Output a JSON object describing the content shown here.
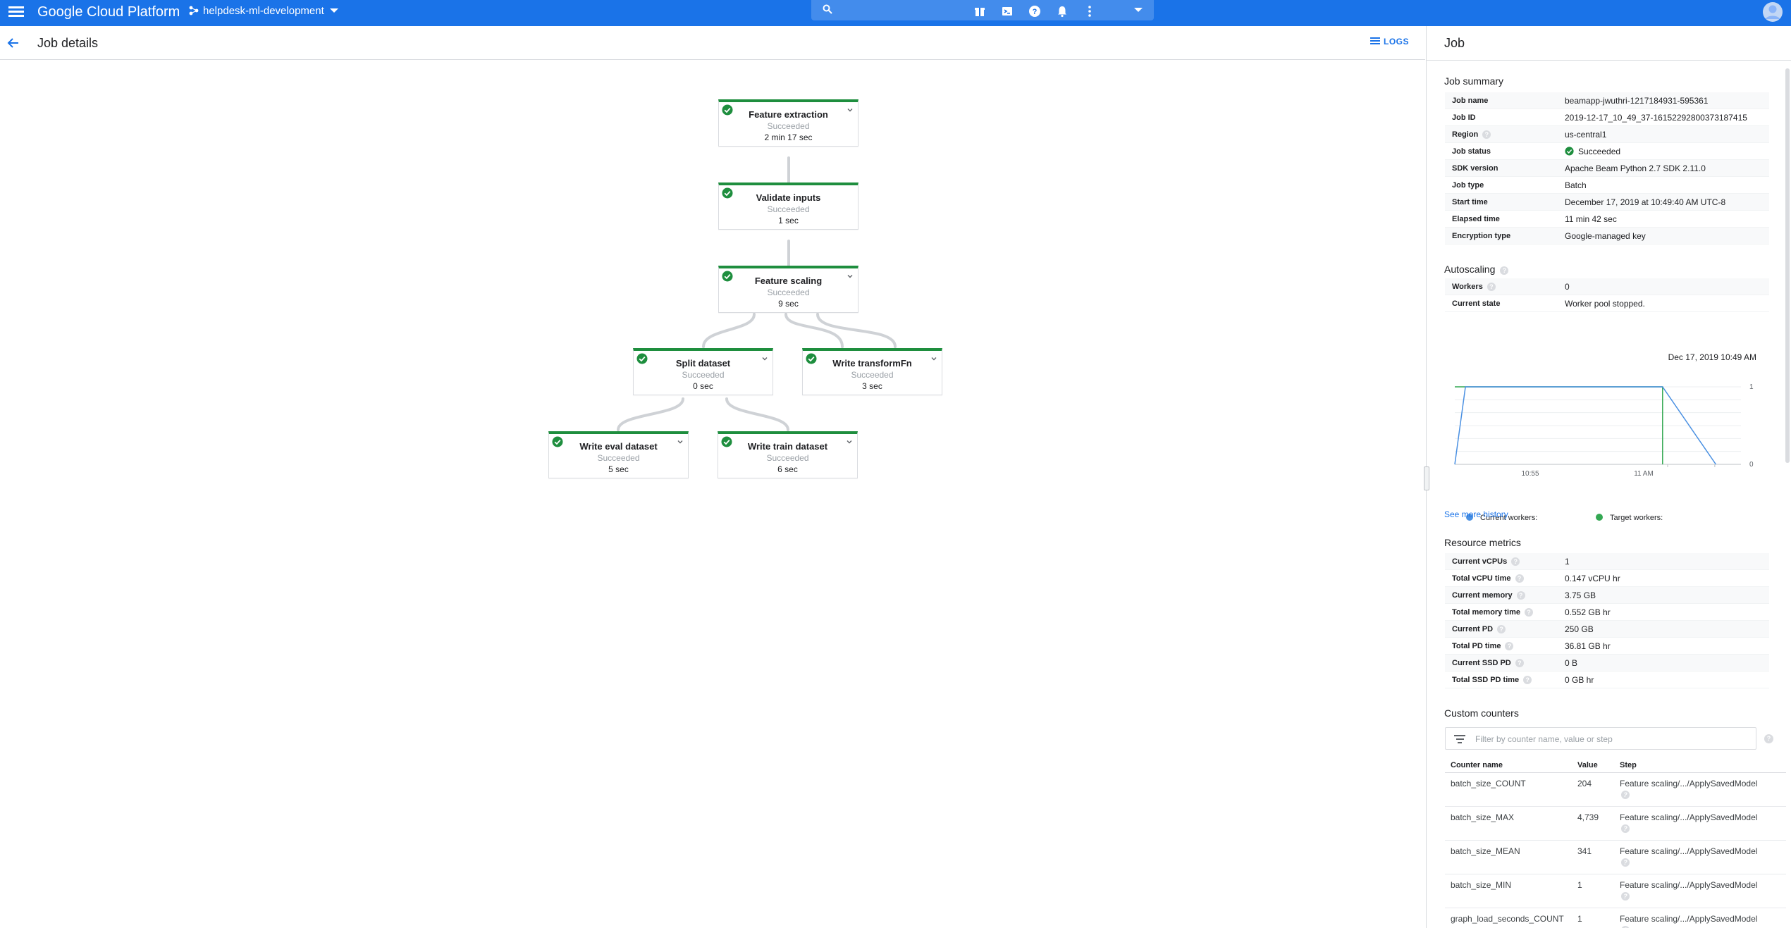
{
  "topbar": {
    "brand": "Google Cloud Platform",
    "project": "helpdesk-ml-development",
    "search_placeholder": "",
    "icons": [
      "gift-icon",
      "cloud-shell-icon",
      "help-icon",
      "notifications-icon",
      "more-vert-icon",
      "account-avatar-icon"
    ]
  },
  "page": {
    "title": "Job details",
    "logs_label": "LOGS"
  },
  "graph": {
    "nodes": [
      {
        "name": "Feature extraction",
        "status": "Succeeded",
        "time": "2 min 17 sec"
      },
      {
        "name": "Validate inputs",
        "status": "Succeeded",
        "time": "1 sec"
      },
      {
        "name": "Feature scaling",
        "status": "Succeeded",
        "time": "9 sec"
      },
      {
        "name": "Split dataset",
        "status": "Succeeded",
        "time": "0 sec"
      },
      {
        "name": "Write transformFn",
        "status": "Succeeded",
        "time": "3 sec"
      },
      {
        "name": "Write eval dataset",
        "status": "Succeeded",
        "time": "5 sec"
      },
      {
        "name": "Write train dataset",
        "status": "Succeeded",
        "time": "6 sec"
      }
    ],
    "status_color": "#1e8e3e"
  },
  "panel": {
    "title": "Job",
    "summary": {
      "title": "Job summary",
      "rows": [
        {
          "key": "Job name",
          "value": "beamapp-jwuthri-1217184931-595361"
        },
        {
          "key": "Job ID",
          "value": "2019-12-17_10_49_37-16152292800373187415"
        },
        {
          "key": "Region",
          "value": "us-central1",
          "help": "?"
        },
        {
          "key": "Job status",
          "value": "Succeeded"
        },
        {
          "key": "SDK version",
          "value": "Apache Beam Python 2.7 SDK 2.11.0"
        },
        {
          "key": "Job type",
          "value": "Batch"
        },
        {
          "key": "Start time",
          "value": "December 17, 2019 at 10:49:40 AM UTC-8"
        },
        {
          "key": "Elapsed time",
          "value": "11 min 42 sec"
        },
        {
          "key": "Encryption type",
          "value": "Google-managed key"
        }
      ]
    },
    "autoscaling": {
      "title": "Autoscaling",
      "help": "?",
      "rows": [
        {
          "key": "Workers",
          "value": "0",
          "help": "?"
        },
        {
          "key": "Current state",
          "value": "Worker pool stopped."
        }
      ],
      "chart_date": "Dec 17, 2019 10:49 AM",
      "legend": {
        "current": "Current workers:",
        "target": "Target workers:"
      },
      "see_more": "See more history"
    },
    "resources": {
      "title": "Resource metrics",
      "rows": [
        {
          "key": "Current vCPUs",
          "value": "1",
          "help": "?"
        },
        {
          "key": "Total vCPU time",
          "value": "0.147 vCPU hr",
          "help": "?"
        },
        {
          "key": "Current memory",
          "value": "3.75 GB",
          "help": "?"
        },
        {
          "key": "Total memory time",
          "value": "0.552 GB hr",
          "help": "?"
        },
        {
          "key": "Current PD",
          "value": "250 GB",
          "help": "?"
        },
        {
          "key": "Total PD time",
          "value": "36.81 GB hr",
          "help": "?"
        },
        {
          "key": "Current SSD PD",
          "value": "0 B",
          "help": "?"
        },
        {
          "key": "Total SSD PD time",
          "value": "0 GB hr",
          "help": "?"
        }
      ]
    },
    "counters": {
      "title": "Custom counters",
      "filter_placeholder": "Filter by counter name, value or step",
      "help": "?",
      "headers": {
        "name": "Counter name",
        "value": "Value",
        "step": "Step"
      },
      "rows": [
        {
          "name": "batch_size_COUNT",
          "value": "204",
          "step": "Feature scaling/.../ApplySavedModel",
          "help": "?"
        },
        {
          "name": "batch_size_MAX",
          "value": "4,739",
          "step": "Feature scaling/.../ApplySavedModel",
          "help": "?"
        },
        {
          "name": "batch_size_MEAN",
          "value": "341",
          "step": "Feature scaling/.../ApplySavedModel",
          "help": "?"
        },
        {
          "name": "batch_size_MIN",
          "value": "1",
          "step": "Feature scaling/.../ApplySavedModel",
          "help": "?"
        },
        {
          "name": "graph_load_seconds_COUNT",
          "value": "1",
          "step": "Feature scaling/.../ApplySavedModel",
          "help": "?"
        }
      ]
    }
  },
  "chart_data": {
    "type": "line",
    "x_ticks": [
      "10:55",
      "11 AM"
    ],
    "y_ticks": [
      "1",
      "0"
    ],
    "ylim": [
      0,
      1
    ],
    "series": [
      {
        "name": "Current workers:",
        "color": "#4a90e2",
        "points": [
          [
            0,
            0
          ],
          [
            0.04,
            1
          ],
          [
            0.78,
            1
          ],
          [
            0.98,
            0
          ]
        ]
      },
      {
        "name": "Target workers:",
        "color": "#34a853",
        "points": [
          [
            0,
            1
          ],
          [
            0.78,
            1
          ],
          [
            0.78,
            0
          ]
        ]
      }
    ]
  },
  "colors": {
    "accent": "#1a73e8",
    "success": "#1e8e3e"
  }
}
